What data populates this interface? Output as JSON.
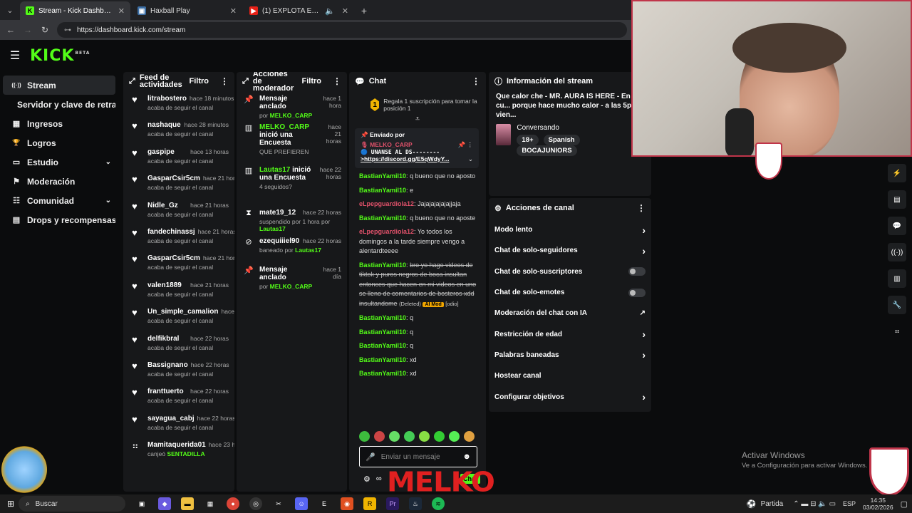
{
  "browser": {
    "tabs": [
      {
        "title": "Stream - Kick Dashboard",
        "active": true
      },
      {
        "title": "Haxball Play",
        "active": false
      },
      {
        "title": "(1)  EXPLOTA EL MONUM",
        "active": false
      }
    ],
    "url": "https://dashboard.kick.com/stream"
  },
  "logo": {
    "text": "KICK",
    "sup": "BETA"
  },
  "sidebar": {
    "items": [
      {
        "label": "Stream",
        "icon": "((·))"
      },
      {
        "label": "Servidor y clave de retransmisión",
        "icon": ""
      },
      {
        "label": "Ingresos",
        "icon": "▦"
      },
      {
        "label": "Logros",
        "icon": "🏆"
      },
      {
        "label": "Estudio",
        "icon": "▭"
      },
      {
        "label": "Moderación",
        "icon": "⚑"
      },
      {
        "label": "Comunidad",
        "icon": "☷"
      },
      {
        "label": "Drops y recompensas",
        "icon": "▤"
      }
    ]
  },
  "feed": {
    "title": "Feed de actividades",
    "filter": "Filtro",
    "items": [
      {
        "user": "litrabostero",
        "time": "hace 18 minutos",
        "desc": "acaba de seguir el canal"
      },
      {
        "user": "nashaque",
        "time": "hace 28 minutos",
        "desc": "acaba de seguir el canal"
      },
      {
        "user": "gaspipe",
        "time": "hace 13 horas",
        "desc": "acaba de seguir el canal"
      },
      {
        "user": "GasparCsir5cm",
        "time": "hace 21 horas",
        "desc": "acaba de seguir el canal"
      },
      {
        "user": "Nidle_Gz",
        "time": "hace 21 horas",
        "desc": "acaba de seguir el canal"
      },
      {
        "user": "fandechinassj",
        "time": "hace 21 horas",
        "desc": "acaba de seguir el canal"
      },
      {
        "user": "GasparCsir5cm",
        "time": "hace 21 horas",
        "desc": "acaba de seguir el canal"
      },
      {
        "user": "valen1889",
        "time": "hace 21 horas",
        "desc": "acaba de seguir el canal"
      },
      {
        "user": "Un_simple_camalion",
        "time": "hace 22 horas",
        "desc": "acaba de seguir el canal"
      },
      {
        "user": "delfikbral",
        "time": "hace 22 horas",
        "desc": "acaba de seguir el canal"
      },
      {
        "user": "Bassignano",
        "time": "hace 22 horas",
        "desc": "acaba de seguir el canal"
      },
      {
        "user": "franttuerto",
        "time": "hace 22 horas",
        "desc": "acaba de seguir el canal"
      },
      {
        "user": "sayagua_cabj",
        "time": "hace 22 horas",
        "desc": "acaba de seguir el canal"
      },
      {
        "user": "Mamitaquerida01",
        "time": "hace 23 horas",
        "desc": "canjeó",
        "extra": "SENTADILLA"
      }
    ]
  },
  "mod": {
    "title": "Acciones de moderador",
    "filter": "Filtro",
    "items": [
      {
        "icon": "pin",
        "title": "Mensaje anclado",
        "time": "hace 1 hora",
        "pre": "por",
        "who": "MELKO_CARP"
      },
      {
        "icon": "poll",
        "title": "MELKO_CARP",
        "title2": "inició una Encuesta",
        "time": "hace 21 horas",
        "desc": "QUE PREFIEREN"
      },
      {
        "icon": "poll",
        "title": "Lautas17",
        "title2": "inició una Encuesta",
        "time": "hace 22 horas",
        "desc": "4 seguidos?"
      },
      {
        "icon": "timeout",
        "title": "mate19_12",
        "time": "hace 22 horas",
        "desc": "suspendido por 1 hora por",
        "who": "Lautas17"
      },
      {
        "icon": "ban",
        "title": "ezequiiiel90",
        "time": "hace 22 horas",
        "desc": "baneado por",
        "who": "Lautas17"
      },
      {
        "icon": "pin",
        "title": "Mensaje anclado",
        "time": "hace 1 día",
        "pre": "por",
        "who": "MELKO_CARP"
      }
    ]
  },
  "chat": {
    "title": "Chat",
    "gift": "Regala 1 suscripción para tomar la posición 1",
    "gift_num": "1",
    "pinned": {
      "header": "Enviado por",
      "user": "MELKO_CARP",
      "text": "UNANSE AL DS--------",
      "link": ">https://discord.gg/E5qWdyY..."
    },
    "messages": [
      {
        "user": "BastianYamil10",
        "color": "#53fc18",
        "text": "q bueno que no aposto"
      },
      {
        "user": "BastianYamil10",
        "color": "#53fc18",
        "text": "e"
      },
      {
        "user": "eLpepguardiola12",
        "color": "#e0516a",
        "text": "Jajajajajajajjaja"
      },
      {
        "user": "BastianYamil10",
        "color": "#53fc18",
        "text": "q bueno que no aposte"
      },
      {
        "user": "eLpepguardiola12",
        "color": "#e0516a",
        "text": "Yo todos los domingos a la tarde siempre vengo a alentardteeee"
      },
      {
        "user": "BastianYamil10",
        "color": "#53fc18",
        "text": "bro yo hago videos de tiktok y puros negros de boca insultan entonces que hacen en mi videos en uno se lleno de comentarios de bosteros xdd insultandome",
        "deleted": "(Deleted)",
        "ai": "AI Mod",
        "tag": "[odio]"
      },
      {
        "user": "BastianYamil10",
        "color": "#53fc18",
        "text": "q"
      },
      {
        "user": "BastianYamil10",
        "color": "#53fc18",
        "text": "q"
      },
      {
        "user": "BastianYamil10",
        "color": "#53fc18",
        "text": "q"
      },
      {
        "user": "BastianYamil10",
        "color": "#53fc18",
        "text": "xd"
      },
      {
        "user": "BastianYamil10",
        "color": "#53fc18",
        "text": "xd"
      }
    ],
    "input_placeholder": "Enviar un mensaje",
    "send": "Chat"
  },
  "info": {
    "title": "Información del stream",
    "stream_title": "Que calor che - MR. AURA IS HERE - En cu... porque hace mucho calor - a las 5pm vien...",
    "category": "Conversando",
    "tags": [
      "18+",
      "Spanish",
      "BOCAJUNIORS"
    ]
  },
  "actions": {
    "title": "Acciones de canal",
    "items": [
      {
        "label": "Modo lento",
        "type": "chevron"
      },
      {
        "label": "Chat de solo-seguidores",
        "type": "chevron"
      },
      {
        "label": "Chat de solo-suscriptores",
        "type": "toggle"
      },
      {
        "label": "Chat de solo-emotes",
        "type": "toggle"
      },
      {
        "label": "Moderación del chat con IA",
        "type": "external"
      },
      {
        "label": "Restricción de edad",
        "type": "chevron"
      },
      {
        "label": "Palabras baneadas",
        "type": "chevron"
      },
      {
        "label": "Hostear canal",
        "type": "none"
      },
      {
        "label": "Configurar objetivos",
        "type": "chevron"
      }
    ]
  },
  "overlay": {
    "activate_title": "Activar Windows",
    "activate_sub": "Ve a Configuración para activar Windows.",
    "melko": "MELKO"
  },
  "taskbar": {
    "search": "Buscar",
    "weather": "Partida",
    "lang": "ESP",
    "time": "14:35",
    "date": "03/02/2026"
  }
}
